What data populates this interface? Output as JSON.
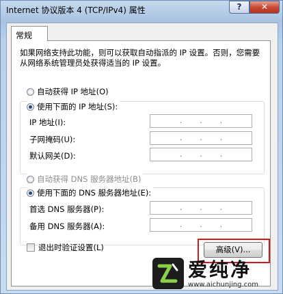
{
  "window": {
    "title": "Internet 协议版本 4 (TCP/IPv4) 属性",
    "help_label": "?",
    "close_label": "✕"
  },
  "tabs": [
    {
      "label": "常规"
    }
  ],
  "description": "如果网络支持此功能，则可以获取自动指派的 IP 设置。否则，您需要从网络系统管理员处获得适当的 IP 设置。",
  "ip_section": {
    "auto_label": "自动获得 IP 地址(O)",
    "manual_label": "使用下面的 IP 地址(S):",
    "selected": "manual",
    "fields": [
      {
        "label": "IP 地址(I):"
      },
      {
        "label": "子网掩码(U):"
      },
      {
        "label": "默认网关(D):"
      }
    ]
  },
  "dns_section": {
    "auto_label": "自动获得 DNS 服务器地址(B)",
    "manual_label": "使用下面的 DNS 服务器地址(E):",
    "selected": "manual",
    "fields": [
      {
        "label": "首选 DNS 服务器(P):"
      },
      {
        "label": "备用 DNS 服务器(A):"
      }
    ]
  },
  "validate_on_exit_label": "退出时验证设置(L)",
  "advanced_button_label": "高级(V)...",
  "watermark": {
    "name": "爱纯净",
    "url": "www.aichunjing.com"
  }
}
